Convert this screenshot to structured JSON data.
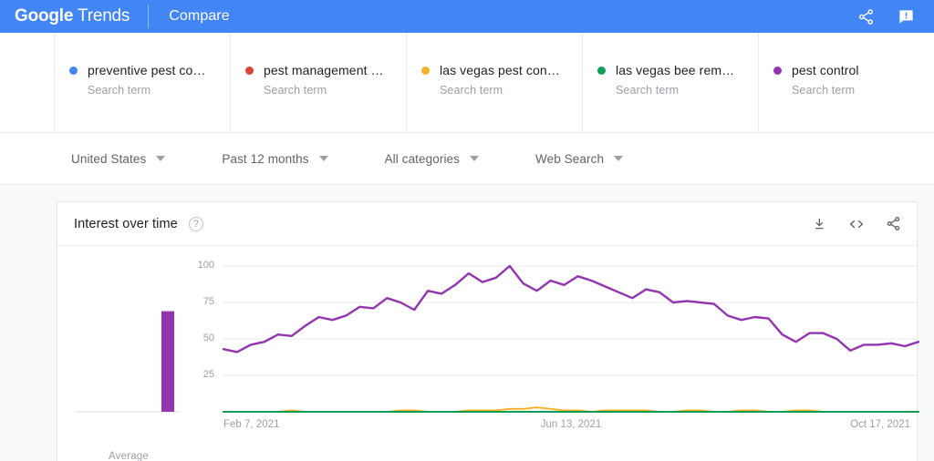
{
  "header": {
    "logo_google": "Google",
    "logo_trends": "Trends",
    "compare": "Compare",
    "share_icon": "share-icon",
    "feedback_icon": "feedback-icon"
  },
  "terms": [
    {
      "title": "preventive pest co…",
      "subtitle": "Search term",
      "color": "#4285f4",
      "dot_icon": "series-dot-blue"
    },
    {
      "title": "pest management …",
      "subtitle": "Search term",
      "color": "#db4437",
      "dot_icon": "series-dot-red"
    },
    {
      "title": "las vegas pest con…",
      "subtitle": "Search term",
      "color": "#f5b125",
      "dot_icon": "series-dot-yellow"
    },
    {
      "title": "las vegas bee rem…",
      "subtitle": "Search term",
      "color": "#0f9d58",
      "dot_icon": "series-dot-green"
    },
    {
      "title": "pest control",
      "subtitle": "Search term",
      "color": "#9334b0",
      "dot_icon": "series-dot-purple"
    }
  ],
  "filters": [
    {
      "label": "United States",
      "caret_icon": "chevron-down-icon"
    },
    {
      "label": "Past 12 months",
      "caret_icon": "chevron-down-icon"
    },
    {
      "label": "All categories",
      "caret_icon": "chevron-down-icon"
    },
    {
      "label": "Web Search",
      "caret_icon": "chevron-down-icon"
    }
  ],
  "card": {
    "title": "Interest over time",
    "help_label": "?",
    "help_icon": "help-circle-icon",
    "tools": [
      {
        "name": "download-icon",
        "label": "Download"
      },
      {
        "name": "embed-code-icon",
        "label": "Embed"
      },
      {
        "name": "share-icon",
        "label": "Share"
      }
    ]
  },
  "chart_data": {
    "type": "line",
    "title": "Interest over time",
    "xlabel": "",
    "ylabel": "",
    "ylim": [
      0,
      100
    ],
    "yticks": [
      25,
      50,
      75,
      100
    ],
    "grid": true,
    "legend": "top-cards",
    "xtick_labels": [
      "Feb 7, 2021",
      "Jun 13, 2021",
      "Oct 17, 2021"
    ],
    "xtick_positions": [
      0,
      0.5,
      0.945
    ],
    "x_start": "Feb 7, 2021",
    "x_end": "Jan 30, 2022",
    "series": [
      {
        "name": "preventive pest co…",
        "color": "#4285f4",
        "values": [
          0,
          0,
          0,
          0,
          0,
          0,
          0,
          0,
          0,
          0,
          0,
          0,
          0,
          0,
          0,
          0,
          0,
          0,
          0,
          0,
          0,
          0,
          0,
          0,
          0,
          0,
          0,
          0,
          0,
          0,
          0,
          0,
          0,
          0,
          0,
          0,
          0,
          0,
          0,
          0,
          0,
          0,
          0,
          0,
          0,
          0,
          0,
          0,
          0,
          0,
          0,
          0
        ]
      },
      {
        "name": "pest management …",
        "color": "#db4437",
        "values": [
          0,
          0,
          0,
          0,
          0,
          0,
          0,
          0,
          0,
          0,
          0,
          0,
          0,
          0,
          0,
          0,
          0,
          0,
          0,
          0,
          0,
          0,
          0,
          0,
          0,
          0,
          0,
          0,
          0,
          0,
          0,
          0,
          0,
          0,
          0,
          0,
          0,
          0,
          0,
          0,
          0,
          0,
          0,
          0,
          0,
          0,
          0,
          0,
          0,
          0,
          0,
          0
        ]
      },
      {
        "name": "las vegas pest con…",
        "color": "#f5b125",
        "values": [
          0,
          0,
          0,
          0,
          0,
          1,
          0,
          0,
          0,
          0,
          0,
          0,
          0,
          1,
          1,
          0,
          0,
          0,
          1,
          1,
          1,
          2,
          2,
          3,
          2,
          1,
          1,
          0,
          1,
          1,
          1,
          1,
          0,
          0,
          1,
          1,
          0,
          0,
          1,
          1,
          0,
          0,
          1,
          1,
          0,
          0,
          0,
          0,
          0,
          0,
          0,
          0
        ]
      },
      {
        "name": "las vegas bee rem…",
        "color": "#0f9d58",
        "values": [
          0,
          0,
          0,
          0,
          0,
          0,
          0,
          0,
          0,
          0,
          0,
          0,
          0,
          0,
          0,
          0,
          0,
          0,
          0,
          0,
          0,
          0,
          0,
          0,
          0,
          0,
          0,
          0,
          0,
          0,
          0,
          0,
          0,
          0,
          0,
          0,
          0,
          0,
          0,
          0,
          0,
          0,
          0,
          0,
          0,
          0,
          0,
          0,
          0,
          0,
          0,
          0
        ]
      },
      {
        "name": "pest control",
        "color": "#9334b0",
        "values": [
          43,
          41,
          46,
          48,
          53,
          52,
          59,
          65,
          63,
          66,
          72,
          71,
          78,
          75,
          70,
          83,
          81,
          87,
          95,
          89,
          92,
          100,
          88,
          83,
          90,
          87,
          93,
          90,
          86,
          82,
          78,
          84,
          82,
          75,
          76,
          75,
          74,
          66,
          63,
          65,
          64,
          53,
          48,
          54,
          54,
          50,
          42,
          46,
          46,
          47,
          45,
          48
        ]
      }
    ],
    "average_panel": {
      "label": "Average",
      "bars": [
        {
          "name": "preventive pest co…",
          "color": "#4285f4",
          "value": 0
        },
        {
          "name": "pest management …",
          "color": "#db4437",
          "value": 0
        },
        {
          "name": "las vegas pest con…",
          "color": "#f5b125",
          "value": 0
        },
        {
          "name": "las vegas bee rem…",
          "color": "#0f9d58",
          "value": 0
        },
        {
          "name": "pest control",
          "color": "#9334b0",
          "value": 69
        }
      ],
      "bar_max": 100
    }
  }
}
